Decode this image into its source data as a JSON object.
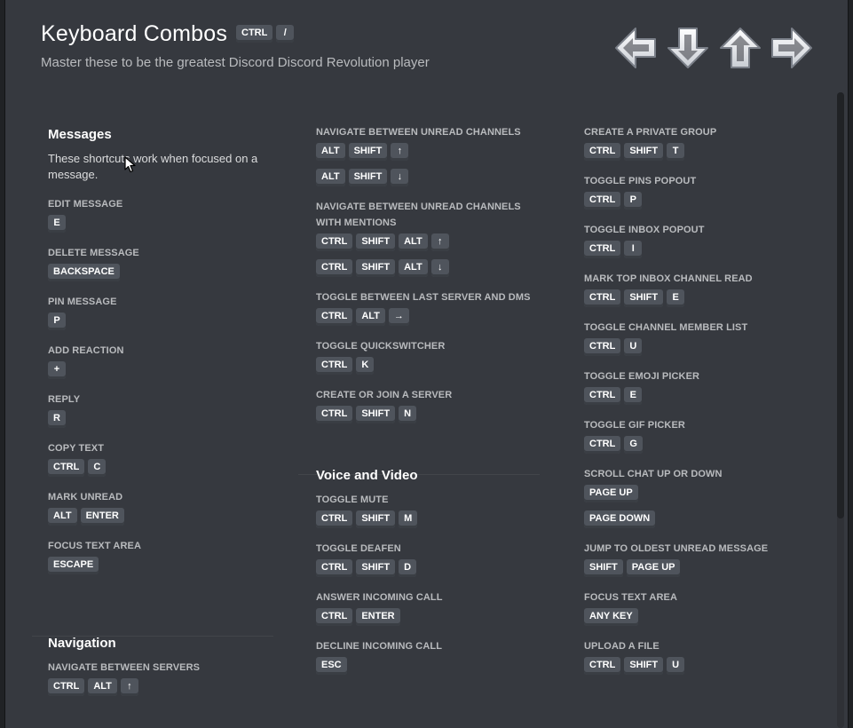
{
  "header": {
    "title": "Keyboard Combos",
    "title_keys": [
      "CTRL",
      "/"
    ],
    "subtitle": "Master these to be the greatest Discord Discord Revolution player",
    "arrow_icons": [
      "arrow-left-icon",
      "arrow-down-icon",
      "arrow-up-icon",
      "arrow-right-icon"
    ]
  },
  "columns": [
    {
      "sections": [
        {
          "title": "Messages",
          "description": "These shortcuts work when focused on a message.",
          "items": [
            {
              "label": "EDIT MESSAGE",
              "combos": [
                [
                  "E"
                ]
              ]
            },
            {
              "label": "DELETE MESSAGE",
              "combos": [
                [
                  "BACKSPACE"
                ]
              ]
            },
            {
              "label": "PIN MESSAGE",
              "combos": [
                [
                  "P"
                ]
              ]
            },
            {
              "label": "ADD REACTION",
              "combos": [
                [
                  "+"
                ]
              ]
            },
            {
              "label": "REPLY",
              "combos": [
                [
                  "R"
                ]
              ]
            },
            {
              "label": "COPY TEXT",
              "combos": [
                [
                  "CTRL",
                  "C"
                ]
              ]
            },
            {
              "label": "MARK UNREAD",
              "combos": [
                [
                  "ALT",
                  "ENTER"
                ]
              ]
            },
            {
              "label": "FOCUS TEXT AREA",
              "combos": [
                [
                  "ESCAPE"
                ]
              ]
            }
          ]
        },
        {
          "title": "Navigation",
          "description": "",
          "items": [
            {
              "label": "NAVIGATE BETWEEN SERVERS",
              "combos": [
                [
                  "CTRL",
                  "ALT",
                  "↑"
                ]
              ]
            }
          ]
        }
      ]
    },
    {
      "sections": [
        {
          "title": "",
          "description": "",
          "items": [
            {
              "label": "NAVIGATE BETWEEN UNREAD CHANNELS",
              "combos": [
                [
                  "ALT",
                  "SHIFT",
                  "↑"
                ],
                [
                  "ALT",
                  "SHIFT",
                  "↓"
                ]
              ]
            },
            {
              "label": "NAVIGATE BETWEEN UNREAD CHANNELS WITH MENTIONS",
              "combos": [
                [
                  "CTRL",
                  "SHIFT",
                  "ALT",
                  "↑"
                ],
                [
                  "CTRL",
                  "SHIFT",
                  "ALT",
                  "↓"
                ]
              ]
            },
            {
              "label": "TOGGLE BETWEEN LAST SERVER AND DMS",
              "combos": [
                [
                  "CTRL",
                  "ALT",
                  "→"
                ]
              ]
            },
            {
              "label": "TOGGLE QUICKSWITCHER",
              "combos": [
                [
                  "CTRL",
                  "K"
                ]
              ]
            },
            {
              "label": "CREATE OR JOIN A SERVER",
              "combos": [
                [
                  "CTRL",
                  "SHIFT",
                  "N"
                ]
              ]
            }
          ]
        },
        {
          "title": "Voice and Video",
          "description": "",
          "items": [
            {
              "label": "TOGGLE MUTE",
              "combos": [
                [
                  "CTRL",
                  "SHIFT",
                  "M"
                ]
              ]
            },
            {
              "label": "TOGGLE DEAFEN",
              "combos": [
                [
                  "CTRL",
                  "SHIFT",
                  "D"
                ]
              ]
            },
            {
              "label": "ANSWER INCOMING CALL",
              "combos": [
                [
                  "CTRL",
                  "ENTER"
                ]
              ]
            },
            {
              "label": "DECLINE INCOMING CALL",
              "combos": [
                [
                  "ESC"
                ]
              ]
            }
          ]
        }
      ]
    },
    {
      "sections": [
        {
          "title": "",
          "description": "",
          "items": [
            {
              "label": "CREATE A PRIVATE GROUP",
              "combos": [
                [
                  "CTRL",
                  "SHIFT",
                  "T"
                ]
              ]
            },
            {
              "label": "TOGGLE PINS POPOUT",
              "combos": [
                [
                  "CTRL",
                  "P"
                ]
              ]
            },
            {
              "label": "TOGGLE INBOX POPOUT",
              "combos": [
                [
                  "CTRL",
                  "I"
                ]
              ]
            },
            {
              "label": "MARK TOP INBOX CHANNEL READ",
              "combos": [
                [
                  "CTRL",
                  "SHIFT",
                  "E"
                ]
              ]
            },
            {
              "label": "TOGGLE CHANNEL MEMBER LIST",
              "combos": [
                [
                  "CTRL",
                  "U"
                ]
              ]
            },
            {
              "label": "TOGGLE EMOJI PICKER",
              "combos": [
                [
                  "CTRL",
                  "E"
                ]
              ]
            },
            {
              "label": "TOGGLE GIF PICKER",
              "combos": [
                [
                  "CTRL",
                  "G"
                ]
              ]
            },
            {
              "label": "SCROLL CHAT UP OR DOWN",
              "combos": [
                [
                  "PAGE UP"
                ],
                [
                  "PAGE DOWN"
                ]
              ]
            },
            {
              "label": "JUMP TO OLDEST UNREAD MESSAGE",
              "combos": [
                [
                  "SHIFT",
                  "PAGE UP"
                ]
              ]
            },
            {
              "label": "FOCUS TEXT AREA",
              "combos": [
                [
                  "ANY KEY"
                ]
              ]
            },
            {
              "label": "UPLOAD A FILE",
              "combos": [
                [
                  "CTRL",
                  "SHIFT",
                  "U"
                ]
              ]
            }
          ]
        }
      ]
    }
  ],
  "colors": {
    "background": "#36393f",
    "key": "#4f545c",
    "label": "#b9bbbe",
    "title": "#ffffff"
  }
}
